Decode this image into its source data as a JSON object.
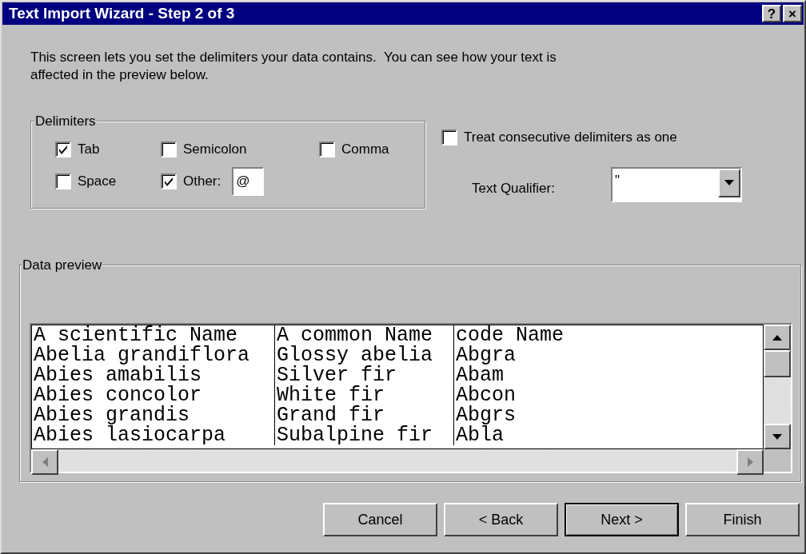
{
  "window": {
    "title": "Text Import Wizard - Step 2 of 3",
    "title_buttons": [
      "?",
      "×"
    ]
  },
  "description": "This screen lets you set the delimiters your data contains.  You can see how your text is affected in the preview below.",
  "delimiters": {
    "label": "Delimiters",
    "options": [
      {
        "label": "Tab",
        "checked": true
      },
      {
        "label": "Semicolon",
        "checked": false
      },
      {
        "label": "Comma",
        "checked": false
      },
      {
        "label": "Space",
        "checked": false
      },
      {
        "label": "Other:",
        "checked": true,
        "value": "@"
      }
    ]
  },
  "consecutive": {
    "label": "Treat consecutive delimiters as one",
    "checked": false
  },
  "text_qualifier": {
    "label": "Text Qualifier:",
    "value": "\""
  },
  "data_preview": {
    "label": "Data preview",
    "rows": [
      [
        "A scientific Name",
        "A common Name",
        "code Name"
      ],
      [
        "Abelia grandiflora",
        "Glossy abelia",
        "Abgra"
      ],
      [
        "Abies amabilis",
        "Silver fir",
        "Abam"
      ],
      [
        "Abies concolor",
        "White fir",
        "Abcon"
      ],
      [
        "Abies grandis",
        "Grand fir",
        "Abgrs"
      ],
      [
        "Abies lasiocarpa",
        "Subalpine fir",
        "Abla"
      ]
    ]
  },
  "buttons": [
    {
      "label": "Cancel",
      "default": false
    },
    {
      "label": "< Back",
      "default": false
    },
    {
      "label": "Next >",
      "default": true
    },
    {
      "label": "Finish",
      "default": false
    }
  ]
}
